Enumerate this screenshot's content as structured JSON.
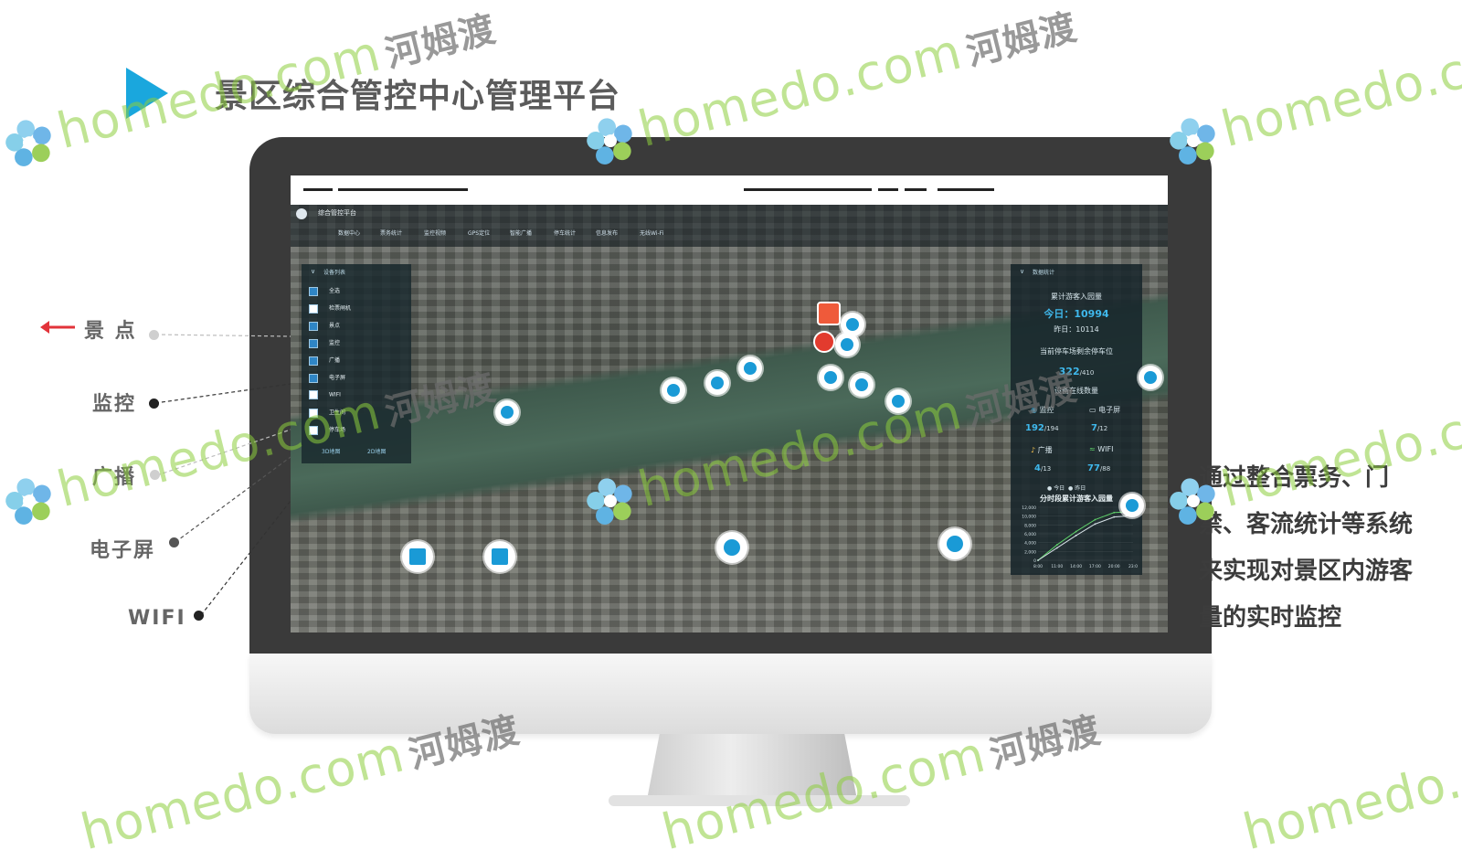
{
  "title": "景区综合管控中心管理平台",
  "watermark": {
    "text": "homedo.com",
    "zh": "河姆渡"
  },
  "app": {
    "name": "综合管控平台",
    "nav": [
      "数据中心",
      "票务统计",
      "监控视频",
      "GPS定位",
      "智能广播",
      "停车统计",
      "信息发布",
      "无线Wi-Fi"
    ]
  },
  "device_panel": {
    "title": "设备列表",
    "items": [
      {
        "label": "全选",
        "checked": true
      },
      {
        "label": "检票闸机",
        "checked": false
      },
      {
        "label": "景点",
        "checked": true
      },
      {
        "label": "监控",
        "checked": true
      },
      {
        "label": "广播",
        "checked": true
      },
      {
        "label": "电子屏",
        "checked": true
      },
      {
        "label": "WIFI",
        "checked": false
      },
      {
        "label": "卫生间",
        "checked": false
      },
      {
        "label": "停车场",
        "checked": false
      }
    ],
    "footer": [
      "3D地图",
      "2D地图"
    ]
  },
  "stats_panel": {
    "title": "数据统计",
    "visitor_heading": "累计游客入园量",
    "today": "今日：10994",
    "yesterday": "昨日：10114",
    "parking_heading": "当前停车场剩余停车位",
    "parking_value": "322",
    "parking_total": "/410",
    "online_heading": "设备在线数量",
    "devices": [
      {
        "label": "监控",
        "value": "192",
        "total": "/194"
      },
      {
        "label": "电子屏",
        "value": "7",
        "total": "/12"
      },
      {
        "label": "广播",
        "value": "4",
        "total": "/13"
      },
      {
        "label": "WIFI",
        "value": "77",
        "total": "/88"
      }
    ],
    "chart_legend": [
      "今日",
      "昨日"
    ],
    "chart_title": "分时段累计游客入园量"
  },
  "chart_data": {
    "type": "line",
    "title": "分时段累计游客入园量",
    "x": [
      "8:00",
      "11:00",
      "14:00",
      "17:00",
      "20:00",
      "23:0"
    ],
    "yticks": [
      "12,000",
      "10,000",
      "8,000",
      "6,000",
      "4,000",
      "2,000",
      "0"
    ],
    "ylim": [
      0,
      12000
    ],
    "series": [
      {
        "name": "今日",
        "values": [
          0,
          3500,
          6500,
          9200,
          10800,
          10994
        ]
      },
      {
        "name": "昨日",
        "values": [
          0,
          2800,
          5600,
          8200,
          9800,
          10114
        ]
      }
    ]
  },
  "side_labels": {
    "scenic": "景 点",
    "monitor": "监控",
    "broadcast": "广播",
    "screen": "电子屏",
    "wifi": "WIFI"
  },
  "description": "通过整合票务、门禁、客流统计等系统来实现对景区内游客量的实时监控",
  "colors": {
    "accent": "#1aa7dd",
    "arrow": "#e2333a",
    "value": "#3fb8ec"
  }
}
